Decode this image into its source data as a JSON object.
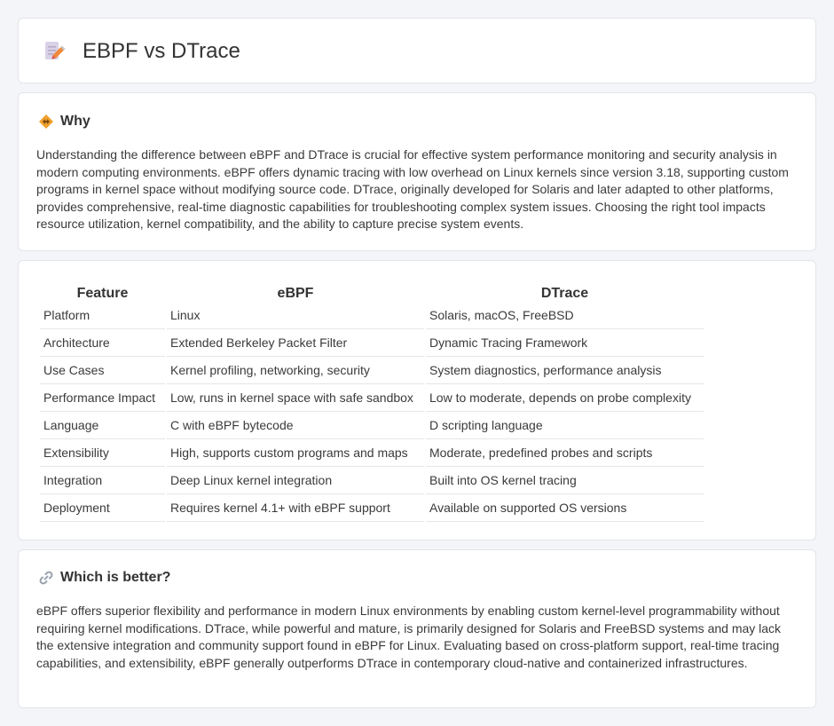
{
  "header": {
    "title": "EBPF vs DTrace",
    "icon": "document-pencil-icon"
  },
  "why": {
    "heading": "Why",
    "icon": "diamond-arrows-icon",
    "text": "Understanding the difference between eBPF and DTrace is crucial for effective system performance monitoring and security analysis in modern computing environments. eBPF offers dynamic tracing with low overhead on Linux kernels since version 3.18, supporting custom programs in kernel space without modifying source code. DTrace, originally developed for Solaris and later adapted to other platforms, provides comprehensive, real-time diagnostic capabilities for troubleshooting complex system issues. Choosing the right tool impacts resource utilization, kernel compatibility, and the ability to capture precise system events."
  },
  "table": {
    "headers": [
      "Feature",
      "eBPF",
      "DTrace"
    ],
    "rows": [
      [
        "Platform",
        "Linux",
        "Solaris, macOS, FreeBSD"
      ],
      [
        "Architecture",
        "Extended Berkeley Packet Filter",
        "Dynamic Tracing Framework"
      ],
      [
        "Use Cases",
        "Kernel profiling, networking, security",
        "System diagnostics, performance analysis"
      ],
      [
        "Performance Impact",
        "Low, runs in kernel space with safe sandbox",
        "Low to moderate, depends on probe complexity"
      ],
      [
        "Language",
        "C with eBPF bytecode",
        "D scripting language"
      ],
      [
        "Extensibility",
        "High, supports custom programs and maps",
        "Moderate, predefined probes and scripts"
      ],
      [
        "Integration",
        "Deep Linux kernel integration",
        "Built into OS kernel tracing"
      ],
      [
        "Deployment",
        "Requires kernel 4.1+ with eBPF support",
        "Available on supported OS versions"
      ]
    ]
  },
  "better": {
    "heading": "Which is better?",
    "icon": "link-icon",
    "text": "eBPF offers superior flexibility and performance in modern Linux environments by enabling custom kernel-level programmability without requiring kernel modifications. DTrace, while powerful and mature, is primarily designed for Solaris and FreeBSD systems and may lack the extensive integration and community support found in eBPF for Linux. Evaluating based on cross-platform support, real-time tracing capabilities, and extensibility, eBPF generally outperforms DTrace in contemporary cloud-native and containerized infrastructures."
  },
  "colors": {
    "page_background": "#f4f5f8",
    "card_background": "#ffffff",
    "text": "#3a3a3a",
    "icon_accent": "#f0a02c"
  }
}
